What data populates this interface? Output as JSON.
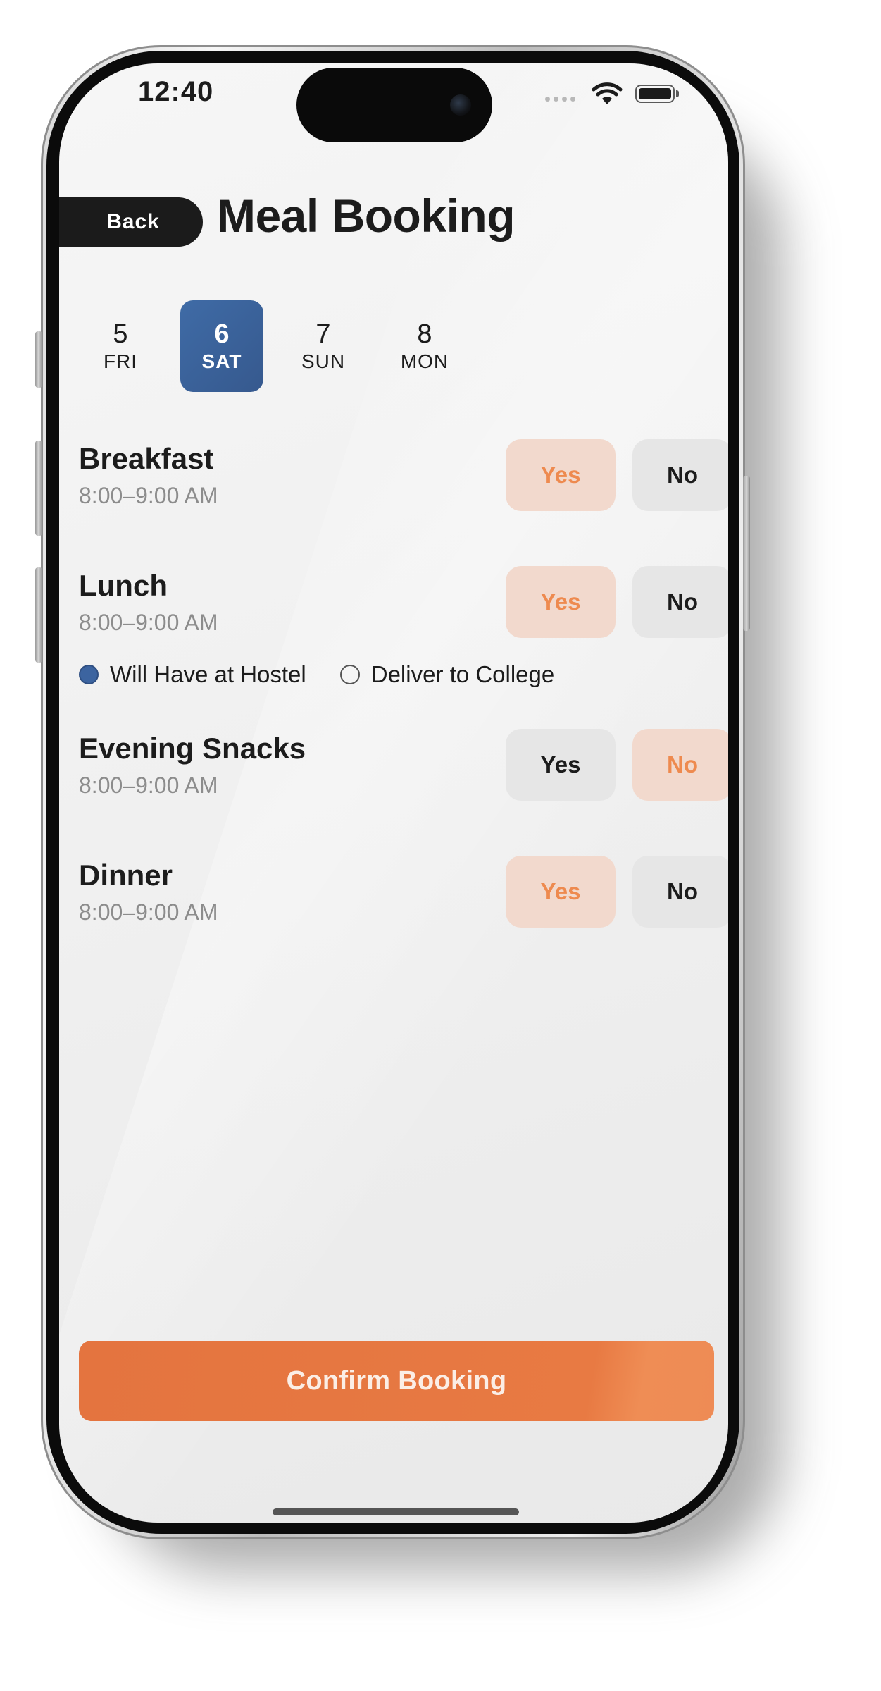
{
  "status_bar": {
    "time": "12:40"
  },
  "header": {
    "back_label": "Back",
    "title": "Meal Booking"
  },
  "dates": [
    {
      "day": "5",
      "weekday": "FRI",
      "selected": false
    },
    {
      "day": "6",
      "weekday": "SAT",
      "selected": true
    },
    {
      "day": "7",
      "weekday": "SUN",
      "selected": false
    },
    {
      "day": "8",
      "weekday": "MON",
      "selected": false
    }
  ],
  "meals": [
    {
      "name": "Breakfast",
      "time": "8:00–9:00 AM",
      "yes_label": "Yes",
      "no_label": "No",
      "selected": "Yes"
    },
    {
      "name": "Lunch",
      "time": "8:00–9:00 AM",
      "yes_label": "Yes",
      "no_label": "No",
      "selected": "Yes"
    },
    {
      "name": "Evening Snacks",
      "time": "8:00–9:00 AM",
      "yes_label": "Yes",
      "no_label": "No",
      "selected": "No"
    },
    {
      "name": "Dinner",
      "time": "8:00–9:00 AM",
      "yes_label": "Yes",
      "no_label": "No",
      "selected": "Yes"
    }
  ],
  "lunch_delivery": {
    "options": [
      {
        "label": "Will Have at Hostel",
        "checked": true
      },
      {
        "label": "Deliver to College",
        "checked": false
      }
    ]
  },
  "confirm_label": "Confirm Booking",
  "colors": {
    "accent": "#e4743f",
    "selected_date": "#3f6ba6",
    "option_selected_bg": "#f2d9cd",
    "option_selected_text": "#ee8a4f"
  },
  "icons": {
    "wifi": "wifi-icon",
    "battery": "battery-icon",
    "signal": "cellular-signal-icon"
  }
}
